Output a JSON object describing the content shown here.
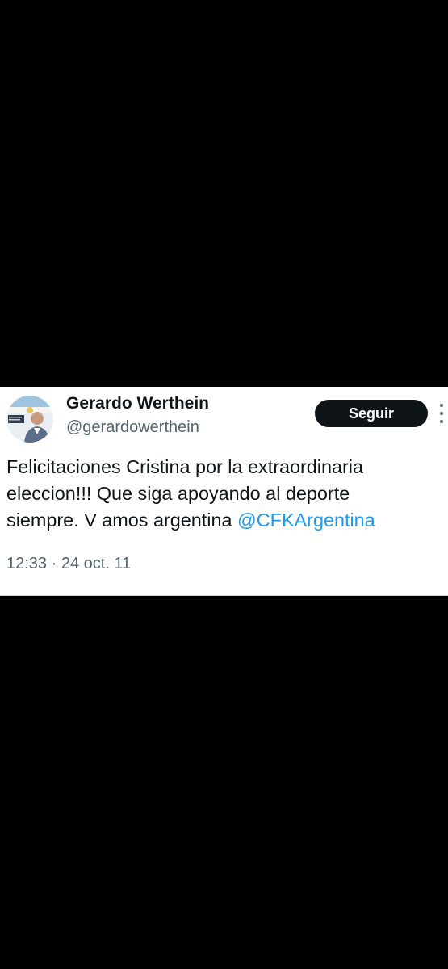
{
  "tweet": {
    "author": {
      "display_name": "Gerardo Werthein",
      "handle": "@gerardowerthein",
      "avatar_icon": "profile-photo"
    },
    "follow_label": "Seguir",
    "more_icon": "more-vertical-icon",
    "text_line_1": "Felicitaciones Cristina por la extraordinaria",
    "text_line_2": "eleccion!!! Que siga apoyando al deporte",
    "text_line_3_prefix": "siempre. V amos argentina ",
    "mention": "@CFKArgentina",
    "timestamp": "12:33 · 24 oct. 11"
  },
  "colors": {
    "background": "#000000",
    "card": "#ffffff",
    "text": "#0f1419",
    "secondary_text": "#536471",
    "mention": "#1d9bf0",
    "button": "#0f1419"
  }
}
